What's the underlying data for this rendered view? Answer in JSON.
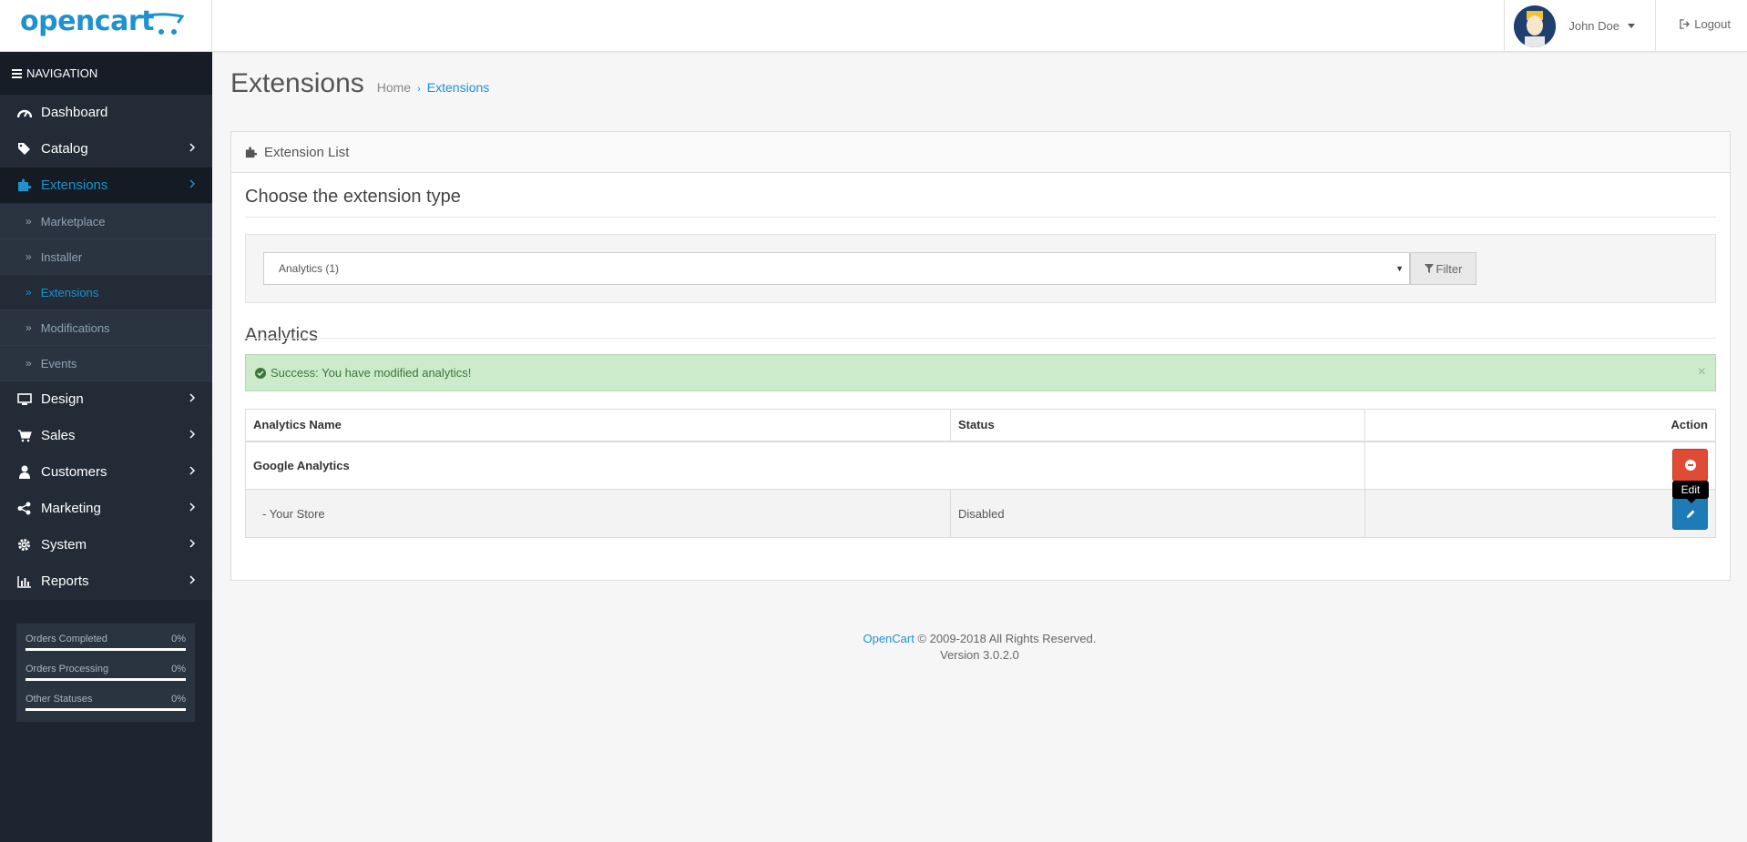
{
  "header": {
    "logo_text": "opencart",
    "user_name": "John Doe",
    "logout_label": "Logout"
  },
  "sidebar": {
    "nav_heading": "NAVIGATION",
    "items": [
      {
        "label": "Dashboard",
        "icon": "dashboard-icon"
      },
      {
        "label": "Catalog",
        "icon": "tags-icon"
      },
      {
        "label": "Extensions",
        "icon": "puzzle-icon",
        "active": true
      },
      {
        "label": "Design",
        "icon": "desktop-icon"
      },
      {
        "label": "Sales",
        "icon": "cart-icon"
      },
      {
        "label": "Customers",
        "icon": "user-icon"
      },
      {
        "label": "Marketing",
        "icon": "share-icon"
      },
      {
        "label": "System",
        "icon": "gear-icon"
      },
      {
        "label": "Reports",
        "icon": "bar-chart-icon"
      }
    ],
    "sub_items": [
      {
        "label": "Marketplace"
      },
      {
        "label": "Installer"
      },
      {
        "label": "Extensions",
        "active": true
      },
      {
        "label": "Modifications"
      },
      {
        "label": "Events"
      }
    ],
    "stats": [
      {
        "label": "Orders Completed",
        "value": "0%",
        "progress": 0
      },
      {
        "label": "Orders Processing",
        "value": "0%",
        "progress": 0
      },
      {
        "label": "Other Statuses",
        "value": "0%",
        "progress": 0
      }
    ]
  },
  "main": {
    "page_title": "Extensions",
    "breadcrumb": [
      "Home",
      "Extensions"
    ],
    "panel_title": "Extension List",
    "choose_title": "Choose the extension type",
    "select_value": "Analytics (1)",
    "filter_label": "Filter",
    "section_title": "Analytics",
    "alert_text": "Success: You have modified analytics!",
    "alert_close": "×",
    "table": {
      "headers": [
        "Analytics Name",
        "Status",
        "Action"
      ],
      "rows": [
        {
          "name": "Google Analytics",
          "status": ""
        },
        {
          "name": "-  Your Store",
          "status": "Disabled"
        }
      ]
    },
    "tooltip": "Edit"
  },
  "footer": {
    "brand": "OpenCart",
    "copyright": " © 2009-2018 All Rights Reserved.",
    "version": "Version 3.0.2.0"
  },
  "colors": {
    "accent": "#1e91cf",
    "sidebar_bg": "#1d2530",
    "danger": "#e04b36",
    "primary": "#1e7bb8",
    "success_bg": "#ccebcb"
  }
}
